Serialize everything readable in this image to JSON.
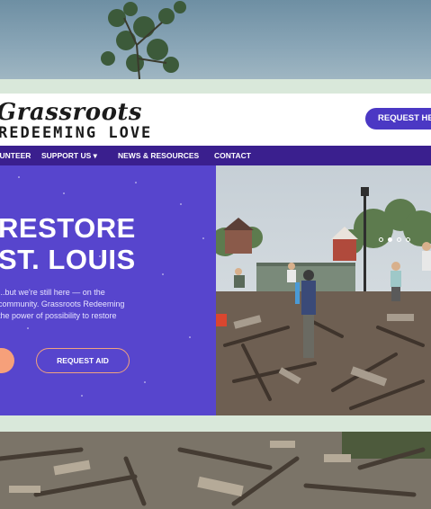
{
  "header": {
    "logo_line1": "Grassroots",
    "logo_line2": "REDEEMING LOVE",
    "request_help": "REQUEST HELP"
  },
  "nav": {
    "items": [
      "VOLUNTEER",
      "SUPPORT US ▾",
      "NEWS & RESOURCES",
      "CONTACT"
    ]
  },
  "hero": {
    "heading_line1": "RESTORE",
    "heading_line2": "ST. LOUIS",
    "text_lines": [
      "...but we're still here — on the",
      "community. Grassroots Redeeming",
      "the power of possibility to restore"
    ],
    "request_aid": "REQUEST AID",
    "slide_count": 4,
    "active_slide": 2
  },
  "colors": {
    "brand_purple": "#5745cd",
    "nav_purple": "#3a1f8e",
    "button_purple": "#4b38c4",
    "accent_orange": "#f6a07a",
    "mint_background": "#d9e8da"
  }
}
